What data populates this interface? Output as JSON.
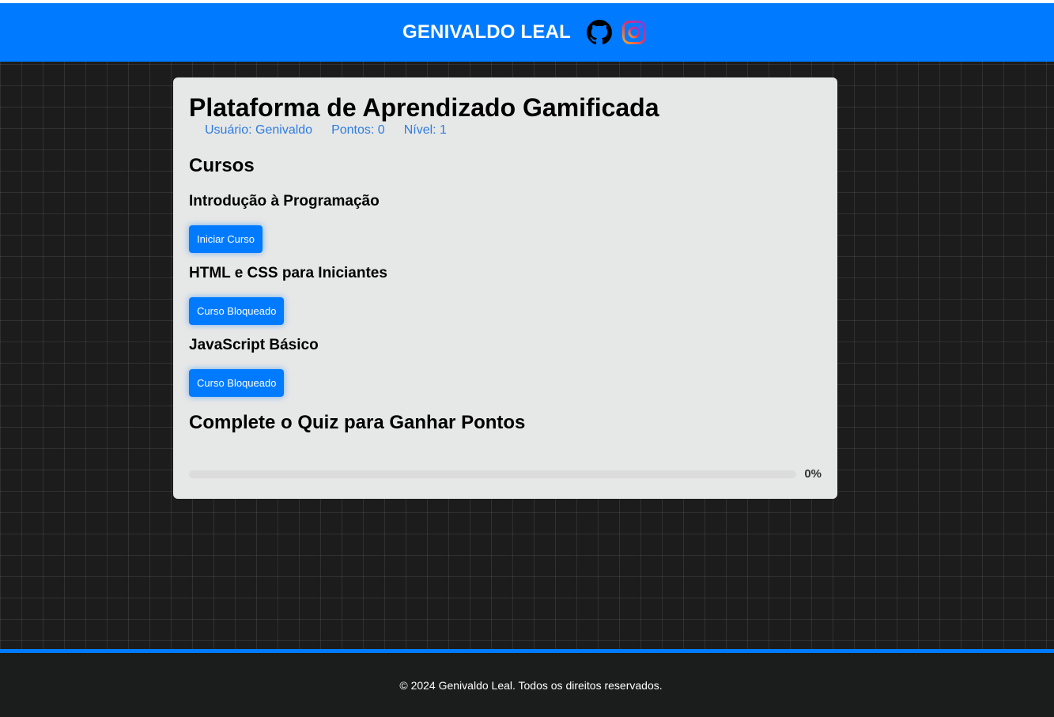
{
  "header": {
    "brand_name": "GENIVALDO LEAL",
    "icons": [
      "github-icon",
      "instagram-icon"
    ]
  },
  "main": {
    "title": "Plataforma de Aprendizado Gamificada",
    "user": {
      "name_text": "Usuário: Genivaldo",
      "points_text": "Pontos: 0",
      "level_text": "Nível: 1"
    },
    "courses_heading": "Cursos",
    "courses": [
      {
        "title": "Introdução à Programação",
        "button": "Iniciar Curso"
      },
      {
        "title": "HTML e CSS para Iniciantes",
        "button": "Curso Bloqueado"
      },
      {
        "title": "JavaScript Básico",
        "button": "Curso Bloqueado"
      }
    ],
    "quiz_heading": "Complete o Quiz para Ganhar Pontos",
    "progress": {
      "percent": 0,
      "label": "0%"
    }
  },
  "footer": {
    "text": "© 2024 Genivaldo Leal. Todos os direitos reservados."
  },
  "colors": {
    "accent": "#007bff",
    "background": "#1c1c1c",
    "card": "#e6e7e7",
    "footer": "#1b1c1c"
  }
}
